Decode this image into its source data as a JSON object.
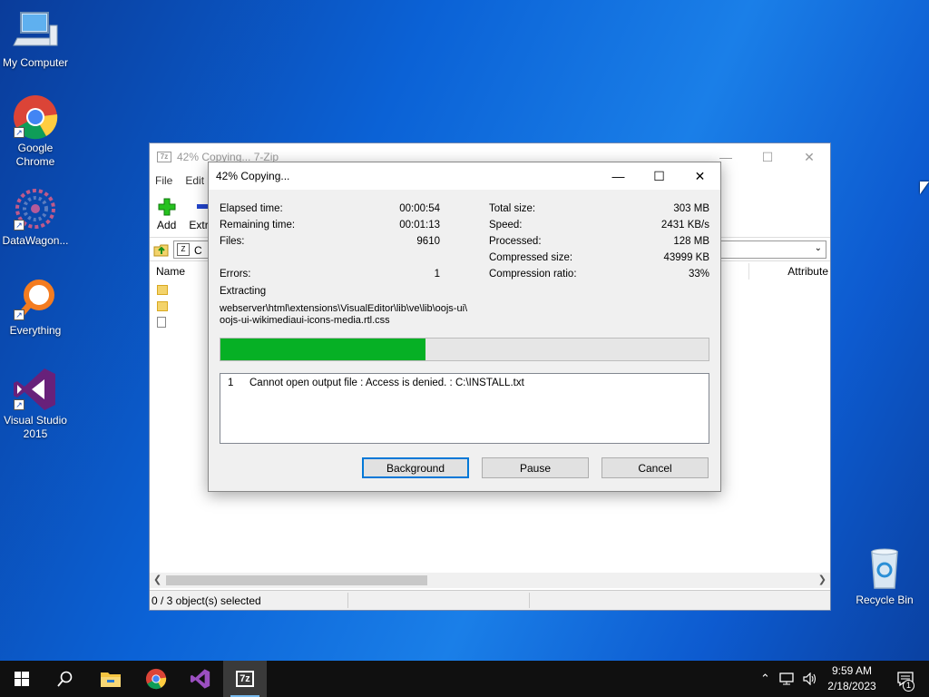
{
  "desktop": {
    "icons": [
      {
        "label": "My Computer",
        "icon": "computer-icon"
      },
      {
        "label": "Google Chrome",
        "icon": "chrome-icon"
      },
      {
        "label": "DataWagon...",
        "icon": "datawagon-icon"
      },
      {
        "label": "Everything",
        "icon": "everything-icon"
      },
      {
        "label": "Visual Studio 2015",
        "icon": "visual-studio-icon"
      },
      {
        "label": "Recycle Bin",
        "icon": "recycle-bin-icon"
      }
    ]
  },
  "main_window": {
    "title": "42% Copying... 7-Zip",
    "menu": [
      "File",
      "Edit"
    ],
    "toolbar": {
      "add_label": "Add",
      "extract_label": "Extr"
    },
    "address_prefix": "C",
    "columns": {
      "name": "Name",
      "attributes": "Attribute"
    },
    "status": "0 / 3 object(s) selected"
  },
  "dialog": {
    "title": "42% Copying...",
    "left_stats": [
      {
        "label": "Elapsed time:",
        "value": "00:00:54"
      },
      {
        "label": "Remaining time:",
        "value": "00:01:13"
      },
      {
        "label": "Files:",
        "value": "9610"
      },
      {
        "label": "Errors:",
        "value": "1"
      }
    ],
    "right_stats": [
      {
        "label": "Total size:",
        "value": "303 MB"
      },
      {
        "label": "Speed:",
        "value": "2431 KB/s"
      },
      {
        "label": "Processed:",
        "value": "128 MB"
      },
      {
        "label": "Compressed size:",
        "value": "43999 KB"
      },
      {
        "label": "Compression ratio:",
        "value": "33%"
      }
    ],
    "operation": "Extracting",
    "current_path_line1": "webserver\\html\\extensions\\VisualEditor\\lib\\ve\\lib\\oojs-ui\\",
    "current_path_line2": "oojs-ui-wikimediaui-icons-media.rtl.css",
    "progress_fraction": 0.42,
    "log": [
      {
        "num": "1",
        "message": "Cannot open output file : Access is denied. : C:\\INSTALL.txt"
      }
    ],
    "buttons": {
      "background": "Background",
      "pause": "Pause",
      "cancel": "Cancel"
    }
  },
  "taskbar": {
    "clock_time": "9:59 AM",
    "clock_date": "2/18/2023",
    "notification_count": "1"
  },
  "colors": {
    "progress_fill": "#06b025",
    "accent": "#0078d7"
  }
}
